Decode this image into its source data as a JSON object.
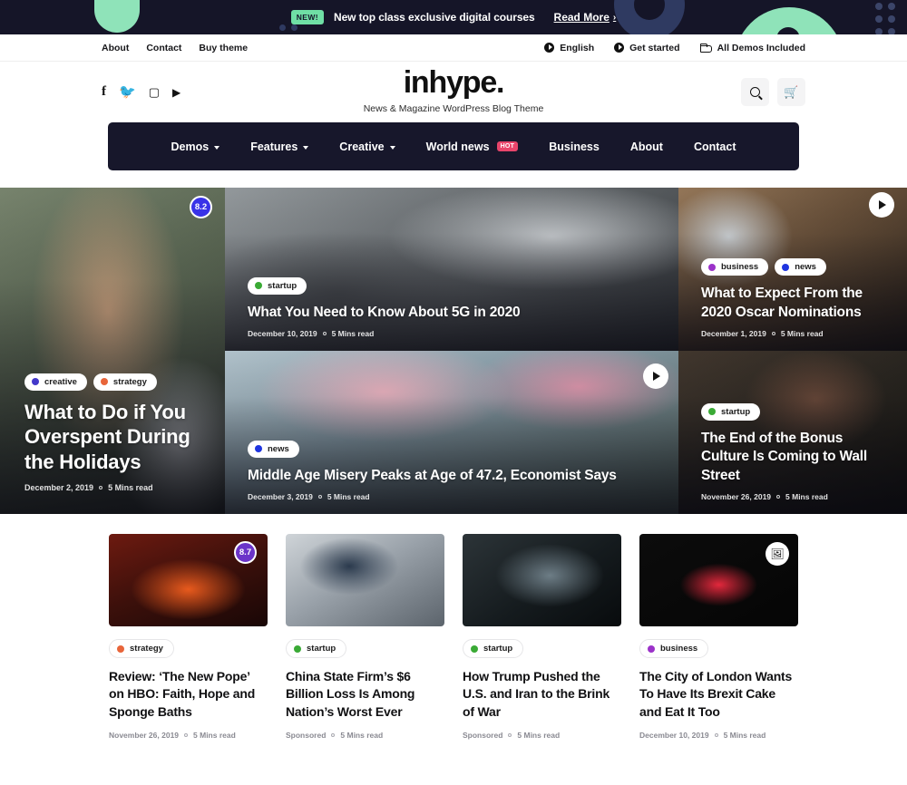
{
  "promo": {
    "badge": "NEW!",
    "text": "New top class exclusive digital courses",
    "read_more": "Read More",
    "chevron": "›"
  },
  "utility": {
    "left_links": [
      "About",
      "Contact",
      "Buy theme"
    ],
    "right_items": [
      {
        "icon": "globe-icon",
        "label": "English"
      },
      {
        "icon": "globe-icon",
        "label": "Get started"
      },
      {
        "icon": "folder-icon",
        "label": "All Demos Included"
      }
    ]
  },
  "header": {
    "social": [
      {
        "name": "facebook-icon",
        "glyph": ""
      },
      {
        "name": "twitter-icon",
        "glyph": "➤"
      },
      {
        "name": "instagram-icon",
        "glyph": "▣"
      },
      {
        "name": "youtube-icon",
        "glyph": "▶"
      }
    ],
    "brand": "inhype.",
    "tagline": "News & Magazine WordPress Blog Theme",
    "search_icon": "search-icon",
    "cart_icon": "cart-icon",
    "cart_glyph": "🛒"
  },
  "nav": {
    "items": [
      {
        "label": "Demos",
        "caret": true,
        "hot": null
      },
      {
        "label": "Features",
        "caret": true,
        "hot": null
      },
      {
        "label": "Creative",
        "caret": true,
        "hot": null
      },
      {
        "label": "World news",
        "caret": false,
        "hot": "HOT"
      },
      {
        "label": "Business",
        "caret": false,
        "hot": null
      },
      {
        "label": "About",
        "caret": false,
        "hot": null
      },
      {
        "label": "Contact",
        "caret": false,
        "hot": null
      }
    ]
  },
  "colors": {
    "startup": "#3aaa35",
    "news": "#1f35e0",
    "business": "#9b32c9",
    "creative": "#4338ca",
    "strategy": "#e8653a",
    "score_blue": "#3932e8",
    "score_purple": "#6b34c9",
    "hot_badge": "#e8456b",
    "nav_bg": "#17172b",
    "promo_bg": "#151528",
    "accent_green": "#8fe3b9"
  },
  "hero": {
    "tiles": [
      {
        "id": "tile-5g",
        "cats": [
          {
            "label": "startup",
            "color": "#3aaa35"
          }
        ],
        "title": "What You Need to Know About 5G in 2020",
        "date": "December 10, 2019",
        "read": "5 Mins read",
        "score": null,
        "play": false
      },
      {
        "id": "tile-middle-age",
        "cats": [
          {
            "label": "news",
            "color": "#1f35e0"
          }
        ],
        "title": "Middle Age Misery Peaks at Age of 47.2, Economist Says",
        "date": "December 3, 2019",
        "read": "5 Mins read",
        "score": null,
        "play": true
      },
      {
        "id": "tile-overspent",
        "cats": [
          {
            "label": "creative",
            "color": "#4338ca"
          },
          {
            "label": "strategy",
            "color": "#e8653a"
          }
        ],
        "title": "What to Do if You Overspent During the Holidays",
        "date": "December 2, 2019",
        "read": "5 Mins read",
        "score": "8.2",
        "play": false
      },
      {
        "id": "tile-oscars",
        "cats": [
          {
            "label": "business",
            "color": "#9b32c9"
          },
          {
            "label": "news",
            "color": "#1f35e0"
          }
        ],
        "title": "What to Expect From the 2020 Oscar Nominations",
        "date": "December 1, 2019",
        "read": "5 Mins read",
        "score": null,
        "play": true
      },
      {
        "id": "tile-bonus-culture",
        "cats": [
          {
            "label": "startup",
            "color": "#3aaa35"
          }
        ],
        "title": "The End of the Bonus Culture Is Coming to Wall Street",
        "date": "November 26, 2019",
        "read": "5 Mins read",
        "score": null,
        "play": false
      }
    ]
  },
  "cards": [
    {
      "id": "card-new-pope",
      "cats": [
        {
          "label": "strategy",
          "color": "#e8653a"
        }
      ],
      "title": "Review: ‘The New Pope’ on HBO: Faith, Hope and Sponge Baths",
      "date": "November 26, 2019",
      "read": "5 Mins read",
      "score": "8.7",
      "gallery": false
    },
    {
      "id": "card-china-state-firm",
      "cats": [
        {
          "label": "startup",
          "color": "#3aaa35"
        }
      ],
      "title": "China State Firm’s $6 Billion Loss Is Among Nation’s Worst Ever",
      "date": "Sponsored",
      "read": "5 Mins read",
      "score": null,
      "gallery": false
    },
    {
      "id": "card-trump-iran",
      "cats": [
        {
          "label": "startup",
          "color": "#3aaa35"
        }
      ],
      "title": "How Trump Pushed the U.S. and Iran to the Brink of War",
      "date": "Sponsored",
      "read": "5 Mins read",
      "score": null,
      "gallery": false
    },
    {
      "id": "card-city-of-london",
      "cats": [
        {
          "label": "business",
          "color": "#9b32c9"
        }
      ],
      "title": "The City of London Wants To Have Its Brexit Cake and Eat It Too",
      "date": "December 10, 2019",
      "read": "5 Mins read",
      "score": null,
      "gallery": true,
      "gallery_glyph": "🖼"
    }
  ]
}
